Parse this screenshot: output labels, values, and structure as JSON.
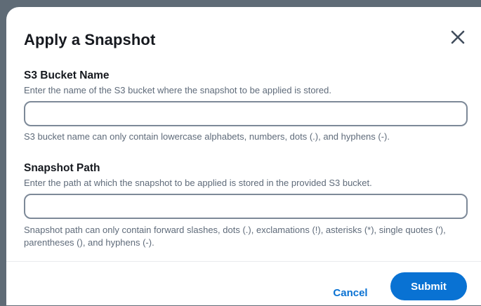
{
  "modal": {
    "title": "Apply a Snapshot",
    "close_icon": "close-icon",
    "fields": {
      "bucket": {
        "label": "S3 Bucket Name",
        "description": "Enter the name of the S3 bucket where the snapshot to be applied is stored.",
        "value": "",
        "placeholder": "",
        "hint": "S3 bucket name can only contain lowercase alphabets, numbers, dots (.), and hyphens (-)."
      },
      "path": {
        "label": "Snapshot Path",
        "description": "Enter the path at which the snapshot to be applied is stored in the provided S3 bucket.",
        "value": "",
        "placeholder": "",
        "hint": "Snapshot path can only contain forward slashes, dots (.), exclamations (!), asterisks (*), single quotes ('), parentheses (), and hyphens (-)."
      }
    },
    "footer": {
      "cancel_label": "Cancel",
      "submit_label": "Submit"
    }
  },
  "colors": {
    "primary": "#0972d3",
    "text": "#16191f",
    "muted": "#5f6b7a",
    "input_border": "#7d8998"
  }
}
